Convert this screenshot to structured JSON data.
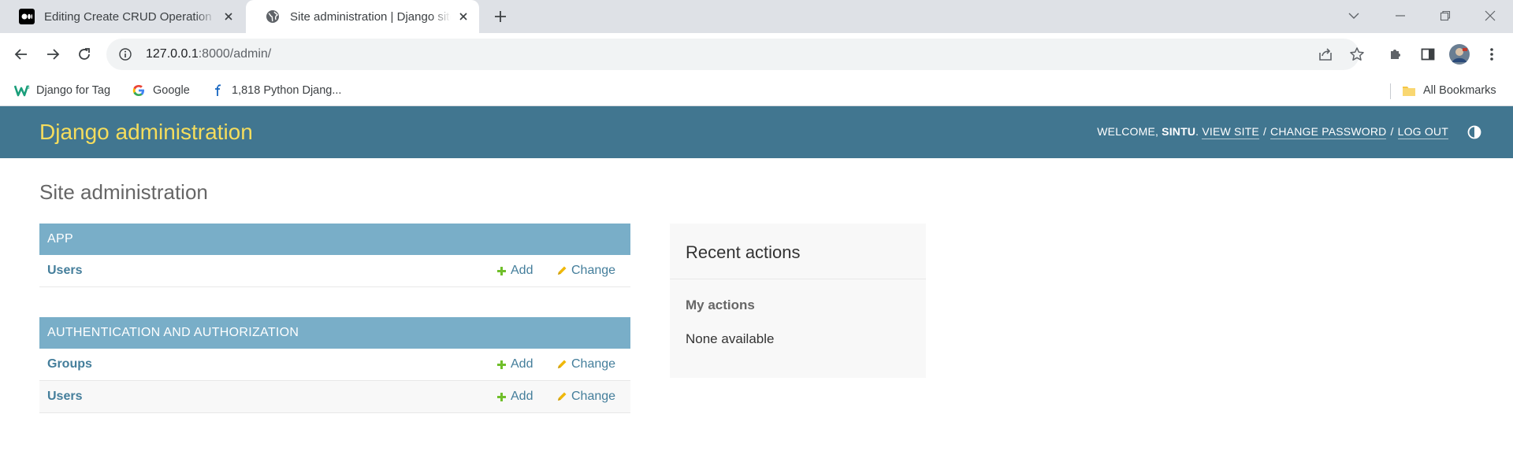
{
  "browser": {
    "tabs": [
      {
        "title": "Editing Create CRUD Operation U",
        "favicon": "medium-icon",
        "active": false
      },
      {
        "title": "Site administration | Django site a",
        "favicon": "globe-icon",
        "active": true
      }
    ],
    "address": {
      "host": "127.0.0.1",
      "rest": ":8000/admin/"
    },
    "bookmarks": [
      {
        "label": "Django for Tag",
        "icon": "w-logo-icon"
      },
      {
        "label": "Google",
        "icon": "google-icon"
      },
      {
        "label": "1,818 Python Djang...",
        "icon": "f-logo-icon"
      }
    ],
    "all_bookmarks": "All Bookmarks"
  },
  "admin": {
    "branding": "Django administration",
    "usertools": {
      "welcome": "WELCOME, ",
      "username": "SINTU",
      "period": ". ",
      "view_site": "VIEW SITE",
      "change_password": "CHANGE PASSWORD",
      "log_out": "LOG OUT",
      "separator": "/"
    },
    "page_title": "Site administration",
    "apps": [
      {
        "caption": "APP",
        "models": [
          {
            "name": "Users",
            "add": "Add",
            "change": "Change"
          }
        ]
      },
      {
        "caption": "AUTHENTICATION AND AUTHORIZATION",
        "models": [
          {
            "name": "Groups",
            "add": "Add",
            "change": "Change"
          },
          {
            "name": "Users",
            "add": "Add",
            "change": "Change"
          }
        ]
      }
    ],
    "recent_actions": {
      "title": "Recent actions",
      "my_actions": "My actions",
      "none": "None available"
    },
    "colors": {
      "header_bg": "#417690",
      "branding": "#f5dd5d",
      "caption_bg": "#79aec8",
      "link": "#447e9b",
      "add_icon": "#70bf2b",
      "change_icon": "#efb80b"
    }
  }
}
